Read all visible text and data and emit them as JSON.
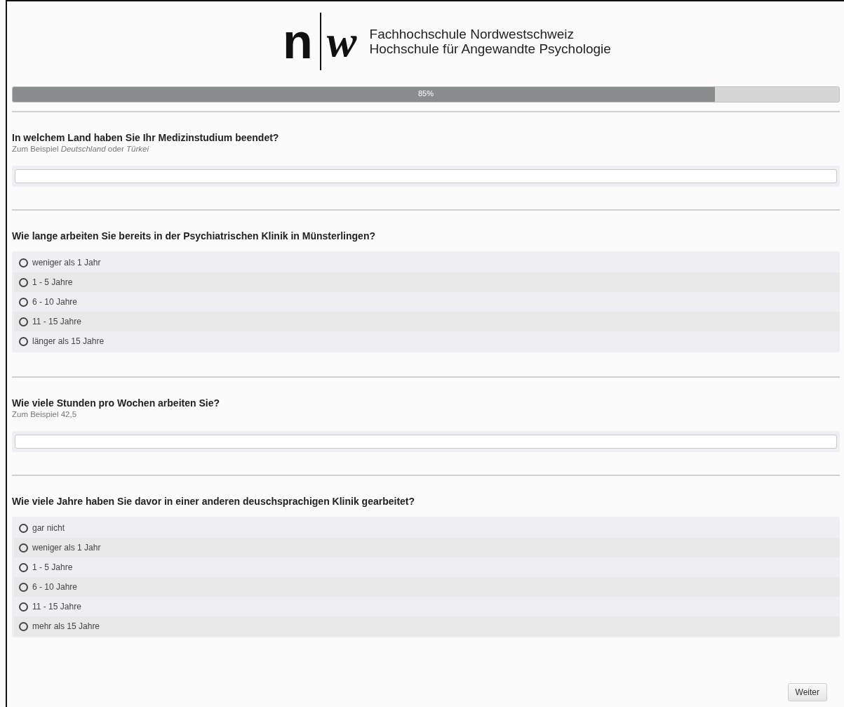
{
  "header": {
    "logo_left": "n",
    "logo_right": "w",
    "institution": "Fachhochschule Nordwestschweiz",
    "school": "Hochschule für Angewandte Psychologie"
  },
  "progress": {
    "level": 0.85,
    "label": "85%"
  },
  "questions": [
    {
      "kind": "text",
      "title": "In welchem Land haben Sie Ihr Medizinstudium beendet?",
      "hint": "Zum Beispiel *Deutschland* oder *Türkei*"
    },
    {
      "kind": "radio",
      "title": "Wie lange arbeiten Sie bereits in der Psychiatrischen Klinik in Münsterlingen?",
      "options": [
        {
          "label": "weniger als 1 Jahr",
          "selected": false
        },
        {
          "label": "1 - 5 Jahre",
          "selected": false
        },
        {
          "label": "6 - 10 Jahre",
          "selected": false
        },
        {
          "label": "11 - 15 Jahre",
          "selected": false
        },
        {
          "label": "länger als 15 Jahre",
          "selected": false
        }
      ]
    },
    {
      "kind": "text",
      "title": "Wie viele Stunden pro Wochen arbeiten Sie?",
      "hint": "Zum Beispiel 42,5"
    },
    {
      "kind": "radio",
      "title": "Wie viele Jahre haben Sie davor in einer anderen deuschsprachigen Klinik gearbeitet?",
      "options": [
        {
          "label": "gar nicht",
          "selected": false
        },
        {
          "label": "weniger als 1 Jahr",
          "selected": false
        },
        {
          "label": "1 - 5 Jahre",
          "selected": false
        },
        {
          "label": "6 - 10 Jahre",
          "selected": false
        },
        {
          "label": "11 - 15 Jahre",
          "selected": false
        },
        {
          "label": "mehr als 15 Jahre",
          "selected": false
        }
      ]
    }
  ],
  "next_button": "Weiter"
}
